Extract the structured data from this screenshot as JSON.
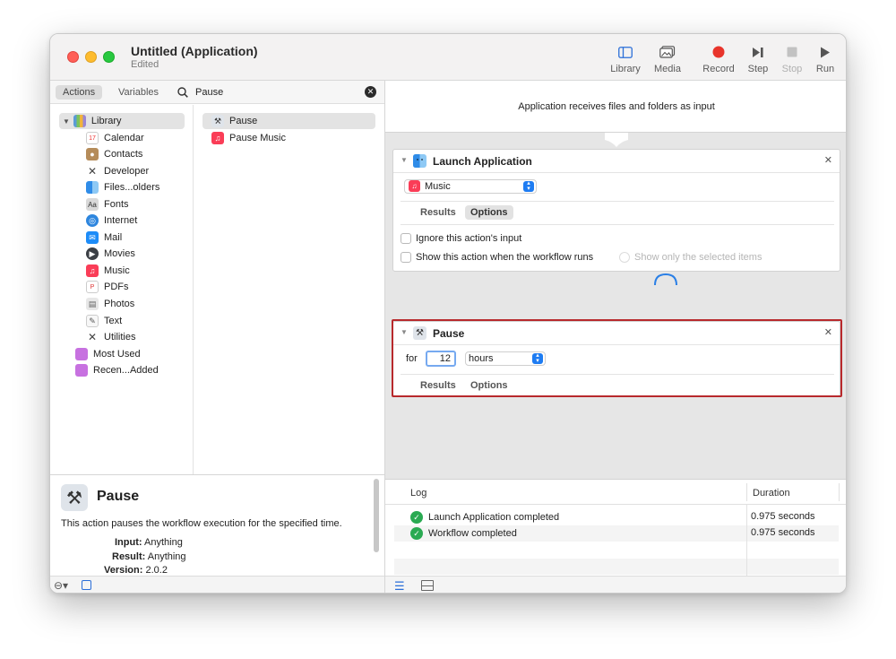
{
  "window": {
    "title": "Untitled (Application)",
    "subtitle": "Edited"
  },
  "toolbar": {
    "library": "Library",
    "media": "Media",
    "record": "Record",
    "step": "Step",
    "stop": "Stop",
    "run": "Run"
  },
  "left": {
    "tab_actions": "Actions",
    "tab_variables": "Variables",
    "search_value": "Pause",
    "library_items": [
      "Library",
      "Calendar",
      "Contacts",
      "Developer",
      "Files...olders",
      "Fonts",
      "Internet",
      "Mail",
      "Movies",
      "Music",
      "PDFs",
      "Photos",
      "Text",
      "Utilities",
      "Most Used",
      "Recen...Added"
    ],
    "actions": [
      "Pause",
      "Pause Music"
    ]
  },
  "description": {
    "title": "Pause",
    "text": "This action pauses the workflow execution for the specified time.",
    "input_label": "Input:",
    "input_value": "Anything",
    "result_label": "Result:",
    "result_value": "Anything",
    "version_label": "Version:",
    "version_value": "2.0.2"
  },
  "workflow": {
    "input_text": "Application receives files and folders as input",
    "launch": {
      "title": "Launch Application",
      "app": "Music",
      "tab_results": "Results",
      "tab_options": "Options",
      "ignore_input": "Ignore this action's input",
      "show_action": "Show this action when the workflow runs",
      "show_selected": "Show only the selected items"
    },
    "pause": {
      "title": "Pause",
      "for_label": "for",
      "amount": "12",
      "unit": "hours",
      "tab_results": "Results",
      "tab_options": "Options"
    }
  },
  "log": {
    "col_log": "Log",
    "col_duration": "Duration",
    "rows": [
      {
        "text": "Launch Application completed",
        "duration": "0.975 seconds"
      },
      {
        "text": "Workflow completed",
        "duration": "0.975 seconds"
      }
    ]
  },
  "colors": {
    "highlight": "#b8292c",
    "record": "#e8342b",
    "accent": "#1e7cf2",
    "success": "#2aaa52"
  }
}
